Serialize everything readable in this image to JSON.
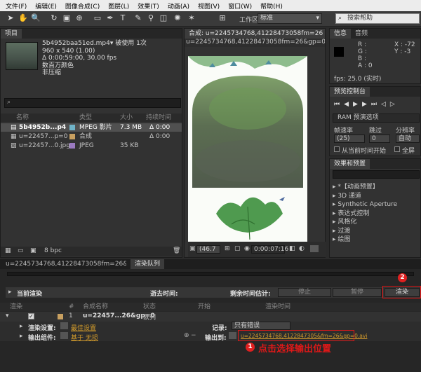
{
  "menu": [
    "文件(F)",
    "编辑(E)",
    "图像合成(C)",
    "图层(L)",
    "效果(T)",
    "动画(A)",
    "视图(V)",
    "窗口(W)",
    "帮助(H)"
  ],
  "toolbar": {
    "workspace_label": "工作区:",
    "workspace_value": "标准",
    "search_placeholder": "搜索帮助"
  },
  "project": {
    "tab": "项目",
    "file_name": "5b4952baa51ed.mp4▾",
    "used": "被使用 1次",
    "info_lines": [
      "960 x 540 (1.00)",
      "Δ 0:00:59:00, 30.00 fps",
      "数百万颜色",
      "非压缩"
    ],
    "columns": [
      "名称",
      "类型",
      "大小",
      "持续时间"
    ],
    "rows": [
      {
        "name": "5b4952b...p4",
        "type": "MPEG 影片",
        "size": "7.3 MB",
        "dur": "Δ 0:00",
        "selected": true,
        "color": "#6fb3c8"
      },
      {
        "name": "u=22457...p=0",
        "type": "合成",
        "size": "",
        "dur": "Δ 0:00",
        "selected": false,
        "color": "#c8a060"
      },
      {
        "name": "u=22457...0.jpg",
        "type": "JPEG",
        "size": "35 KB",
        "dur": "",
        "selected": false,
        "color": "#9a7ac0"
      }
    ],
    "bpc": "8 bpc"
  },
  "composition": {
    "tab": "合成: u=2245734768,41228473058fm=26",
    "sub_tab": "u=2245734768,41228473058fm=26&gp=0",
    "zoom": "(46.7",
    "timecode": "0:00:07:16"
  },
  "info": {
    "tabs": [
      "信息",
      "音频"
    ],
    "r": "R :",
    "g": "G :",
    "b": "B :",
    "a": "A : 0",
    "x": "X : -72",
    "y": "Y : -3",
    "fps": "fps: 25.0 (实时)"
  },
  "preview": {
    "tab": "预览控制台",
    "ram": "RAM 预演选项",
    "labels": [
      "帧速率",
      "跳过",
      "分辨率"
    ],
    "values": [
      "(25)",
      "0",
      "自动"
    ],
    "from_now": "从当前时间开始",
    "fullscreen": "全屏"
  },
  "effects": {
    "tab": "效果和预置",
    "items": [
      "*【动画预置】",
      "3D 通道",
      "Synthetic Aperture",
      "表达式控制",
      "风格化",
      "过渡",
      "绘图"
    ]
  },
  "render": {
    "tabs": [
      "u=2245734768,41228473058fm=26&gp=0",
      "渲染队列"
    ],
    "current": "当前渲染",
    "elapsed": "逝去时间:",
    "remaining": "剩余时间估计:",
    "stop": "停止",
    "pause": "暂停",
    "render_btn": "渲染",
    "columns": [
      "渲染",
      "#",
      "合成名称",
      "状态",
      "开始",
      "渲染时间"
    ],
    "row": {
      "num": "1",
      "name": "u=22457...26&gp=0",
      "status": "队列"
    },
    "render_settings_label": "渲染设置:",
    "render_settings_value": "最佳设置",
    "output_module_label": "输出组件:",
    "output_module_value": "基于 无损",
    "log_label": "记录:",
    "log_value": "只有错误",
    "output_to_label": "输出到:",
    "output_to_value": "u=2245734768,4122847305&fm=26&gp=0.avi",
    "annotation_1": "1",
    "annotation_text": "点击选择输出位置",
    "annotation_2": "2"
  }
}
